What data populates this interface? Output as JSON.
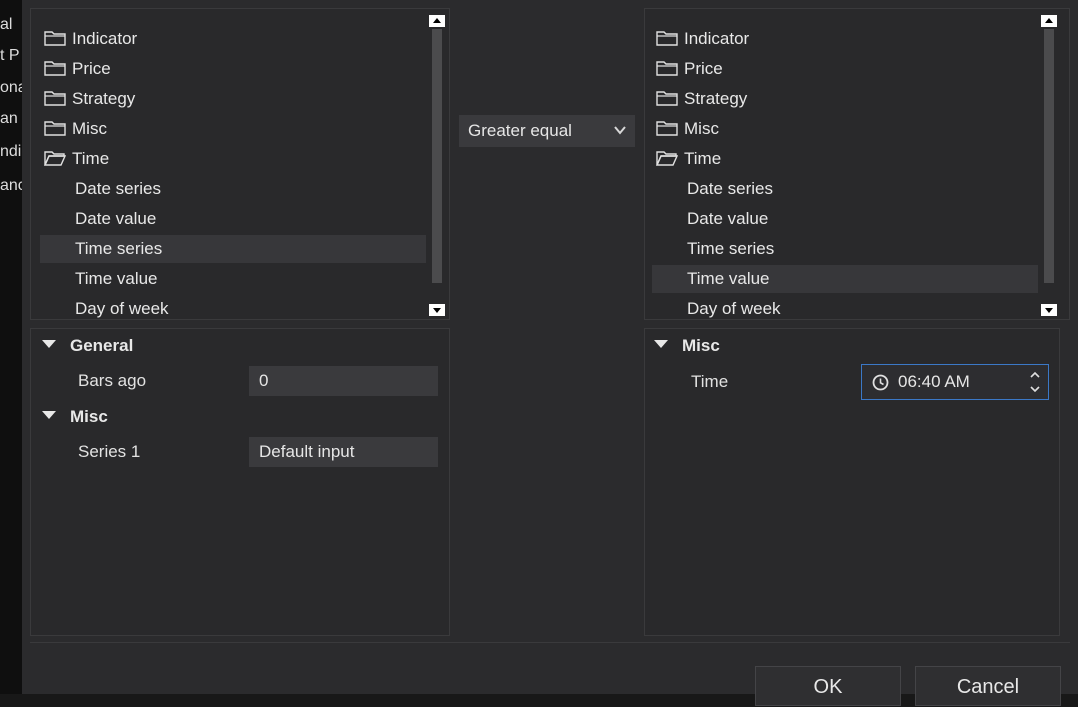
{
  "background_strip": [
    "al",
    "t P",
    "ona",
    "an",
    "ndi",
    "anc"
  ],
  "left_tree": {
    "items": [
      {
        "label": "Indicator",
        "type": "folder"
      },
      {
        "label": "Price",
        "type": "folder"
      },
      {
        "label": "Strategy",
        "type": "folder"
      },
      {
        "label": "Misc",
        "type": "folder"
      },
      {
        "label": "Time",
        "type": "folder-open"
      },
      {
        "label": "Date series",
        "type": "leaf"
      },
      {
        "label": "Date value",
        "type": "leaf"
      },
      {
        "label": "Time series",
        "type": "leaf",
        "selected": true
      },
      {
        "label": "Time value",
        "type": "leaf"
      },
      {
        "label": "Day of week",
        "type": "leaf"
      }
    ]
  },
  "operator": {
    "selected": "Greater equal"
  },
  "right_tree": {
    "items": [
      {
        "label": "Indicator",
        "type": "folder"
      },
      {
        "label": "Price",
        "type": "folder"
      },
      {
        "label": "Strategy",
        "type": "folder"
      },
      {
        "label": "Misc",
        "type": "folder"
      },
      {
        "label": "Time",
        "type": "folder-open"
      },
      {
        "label": "Date series",
        "type": "leaf"
      },
      {
        "label": "Date value",
        "type": "leaf"
      },
      {
        "label": "Time series",
        "type": "leaf"
      },
      {
        "label": "Time value",
        "type": "leaf",
        "selected": true
      },
      {
        "label": "Day of week",
        "type": "leaf"
      }
    ]
  },
  "left_props": {
    "general_title": "General",
    "bars_ago_label": "Bars ago",
    "bars_ago_value": "0",
    "misc_title": "Misc",
    "series1_label": "Series 1",
    "series1_value": "Default input"
  },
  "right_props": {
    "misc_title": "Misc",
    "time_label": "Time",
    "time_value": "06:40 AM"
  },
  "buttons": {
    "ok": "OK",
    "cancel": "Cancel"
  },
  "colors": {
    "accent": "#3b78c7",
    "panel": "#29292b",
    "field": "#3a3a3d"
  }
}
